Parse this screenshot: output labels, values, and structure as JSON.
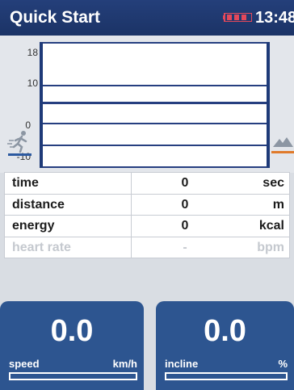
{
  "header": {
    "title": "Quick Start",
    "time": "13:48",
    "battery_icon": "battery-icon"
  },
  "graph": {
    "y_ticks": [
      "18",
      "10",
      "0",
      "-10"
    ],
    "left_icon": "runner-icon",
    "right_icon": "mountain-icon",
    "colors": {
      "line": "#263f80",
      "speed_marker": "#2c5aa0",
      "incline_marker": "#e07a2b"
    }
  },
  "metrics": [
    {
      "label": "time",
      "value": "0",
      "unit": "sec"
    },
    {
      "label": "distance",
      "value": "0",
      "unit": "m"
    },
    {
      "label": "energy",
      "value": "0",
      "unit": "kcal"
    },
    {
      "label": "heart rate",
      "value": "-",
      "unit": "bpm"
    }
  ],
  "speed": {
    "value": "0.0",
    "label": "speed",
    "unit": "km/h",
    "level": 0
  },
  "incline": {
    "value": "0.0",
    "label": "incline",
    "unit": "%",
    "level": 0
  }
}
